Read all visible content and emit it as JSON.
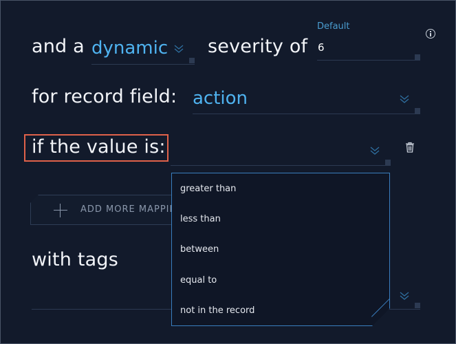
{
  "severity_row": {
    "prefix": "and a",
    "mode_value": "dynamic",
    "middle": "severity of",
    "default_label": "Default",
    "default_value": "6"
  },
  "field_row": {
    "label": "for record field:",
    "value": "action"
  },
  "value_row": {
    "label": "if the value is:"
  },
  "add_button": {
    "label": "ADD MORE MAPPIN"
  },
  "tags_row": {
    "label": "with tags"
  },
  "dropdown": {
    "options": [
      "greater than",
      "less than",
      "between",
      "equal to",
      "not in the record"
    ]
  },
  "icons": [
    "info-icon",
    "chevron-down-icon",
    "trash-icon",
    "plus-icon"
  ],
  "colors": {
    "background": "#121a2b",
    "accent": "#4fb3f0",
    "highlight": "#e0624a",
    "dropdown_border": "#3a7fc0"
  }
}
